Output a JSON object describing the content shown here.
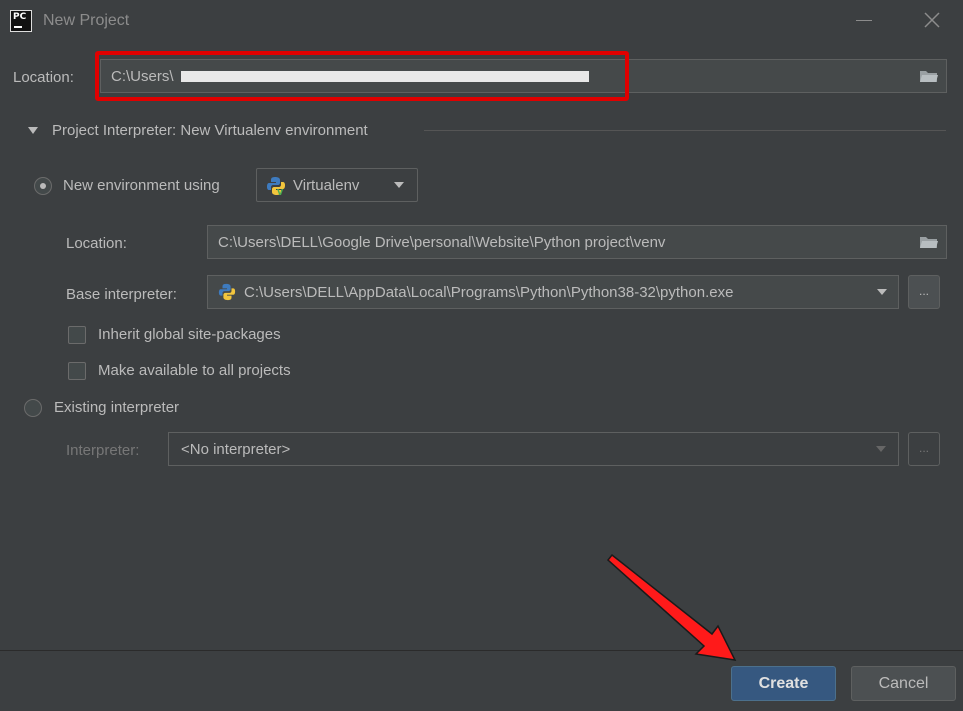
{
  "window": {
    "title": "New Project",
    "logo_text": "PC"
  },
  "location": {
    "label": "Location:",
    "value": "C:\\Users\\"
  },
  "section": {
    "title": "Project Interpreter: New Virtualenv environment"
  },
  "new_env": {
    "label": "New environment using",
    "tool": "Virtualenv",
    "location_label": "Location:",
    "location_value": "C:\\Users\\DELL\\Google Drive\\personal\\Website\\Python project\\venv",
    "base_interpreter_label": "Base interpreter:",
    "base_interpreter_value": "C:\\Users\\DELL\\AppData\\Local\\Programs\\Python\\Python38-32\\python.exe",
    "browse_label": "...",
    "inherit_label": "Inherit global site-packages",
    "available_label": "Make available to all projects"
  },
  "existing": {
    "label": "Existing interpreter",
    "interpreter_label": "Interpreter:",
    "interpreter_value": "<No interpreter>",
    "browse_label": "..."
  },
  "footer": {
    "create_label": "Create",
    "cancel_label": "Cancel"
  },
  "colors": {
    "accent": "#365880",
    "highlight": "#e00000",
    "background": "#3c3f41"
  }
}
